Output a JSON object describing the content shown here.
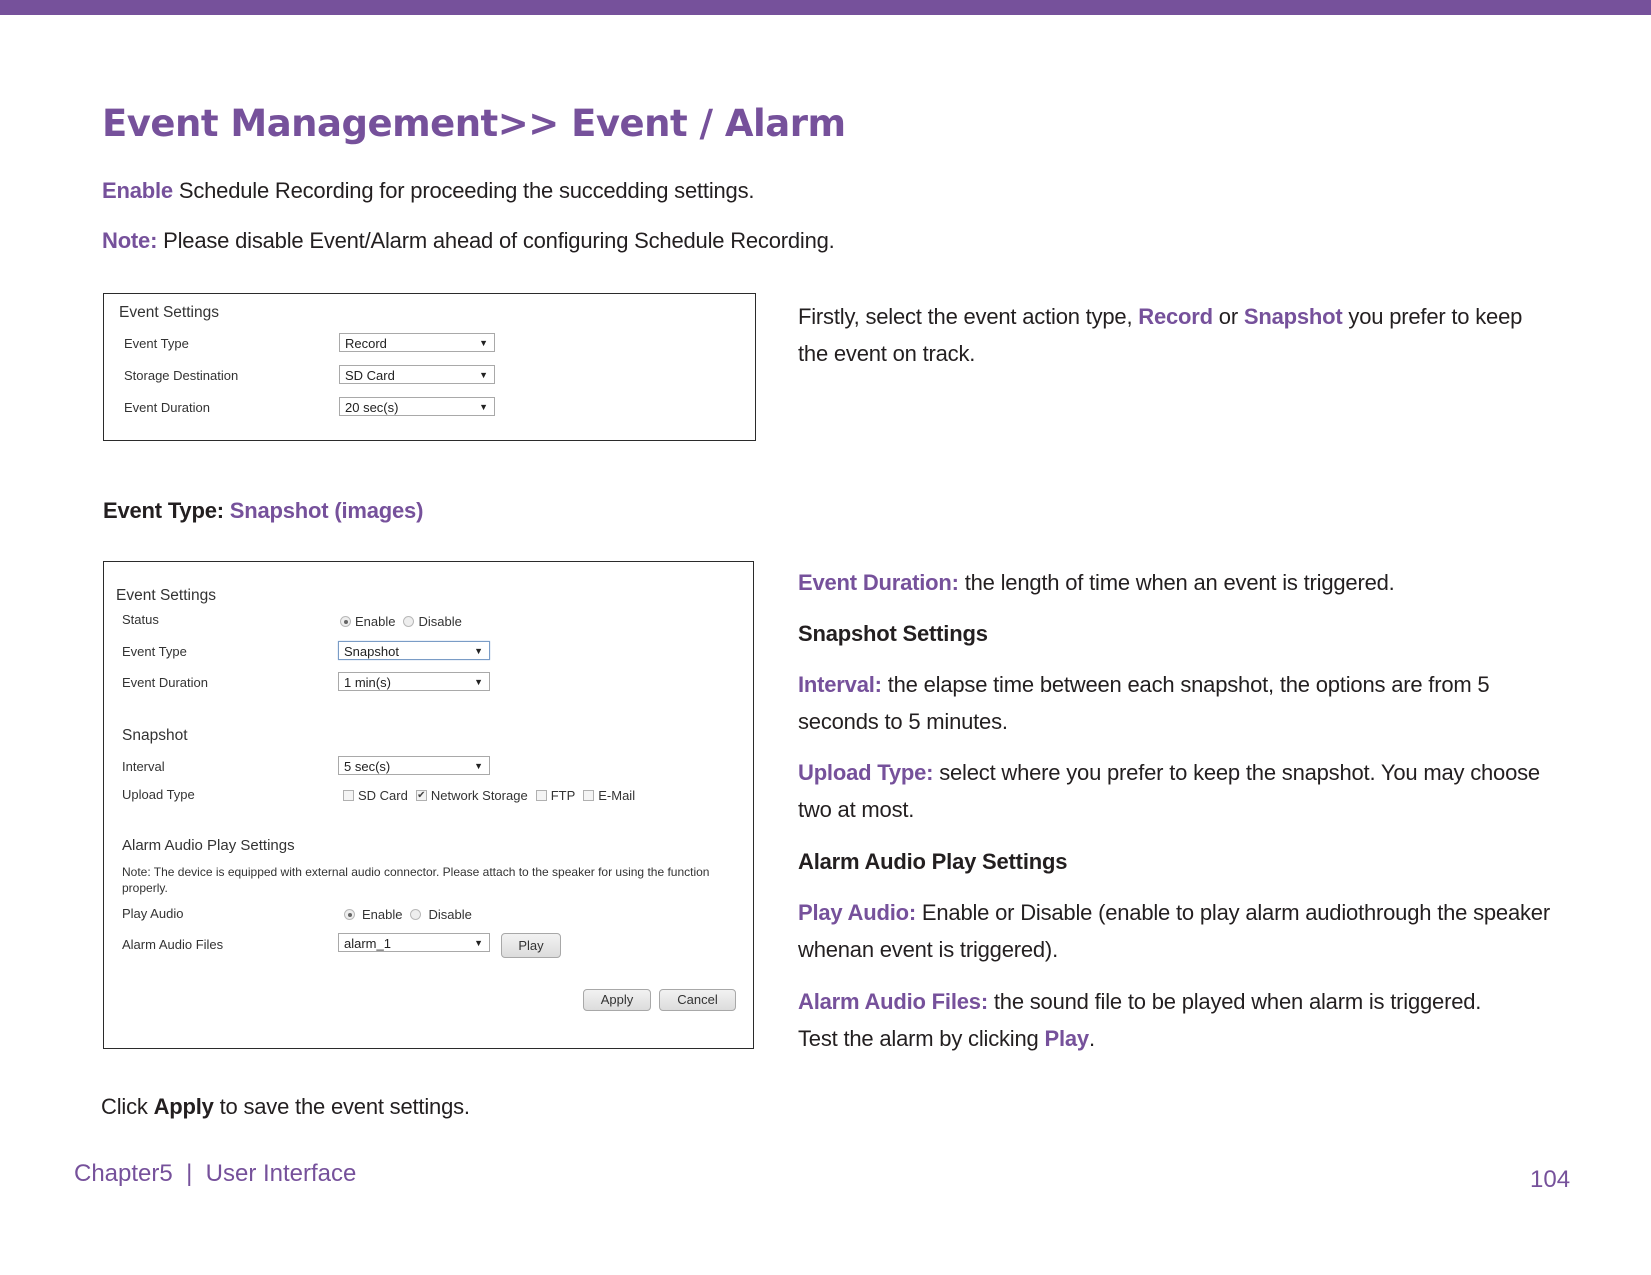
{
  "page": {
    "title": "Event Management>> Event / Alarm",
    "intro": [
      {
        "label": "Enable",
        "text": " Schedule Recording for proceeding the succedding settings."
      },
      {
        "label": "Note:",
        "text": " Please disable Event/Alarm ahead of configuring Schedule Recording."
      }
    ],
    "accent_color": "#76519b"
  },
  "panel1": {
    "section_title": "Event Settings",
    "rows": [
      {
        "label": "Event Type",
        "value": "Record"
      },
      {
        "label": "Storage Destination",
        "value": "SD Card"
      },
      {
        "label": "Event Duration",
        "value": "20 sec(s)"
      }
    ]
  },
  "desc1": {
    "pre": "Firstly, select the event action type, ",
    "opt1": "Record",
    "mid": " or ",
    "opt2": "Snapshot",
    "post": " you prefer to keep the event on track."
  },
  "event_type_heading": {
    "label": "Event Type: ",
    "value": "Snapshot (images)"
  },
  "panel2": {
    "section_title": "Event Settings",
    "status": {
      "label": "Status",
      "options": [
        "Enable",
        "Disable"
      ],
      "selected": "Enable"
    },
    "event_type": {
      "label": "Event Type",
      "value": "Snapshot"
    },
    "event_duration": {
      "label": "Event Duration",
      "value": "1 min(s)"
    },
    "snapshot_title": "Snapshot",
    "interval": {
      "label": "Interval",
      "value": "5 sec(s)"
    },
    "upload_type": {
      "label": "Upload Type",
      "options": [
        {
          "label": "SD Card",
          "checked": false
        },
        {
          "label": "Network Storage",
          "checked": true
        },
        {
          "label": "FTP",
          "checked": false
        },
        {
          "label": "E-Mail",
          "checked": false
        }
      ]
    },
    "alarm_title": "Alarm Audio Play Settings",
    "alarm_note": "Note: The device is equipped with external audio connector. Please attach to the speaker for using the function properly.",
    "play_audio": {
      "label": "Play Audio",
      "options": [
        "Enable",
        "Disable"
      ],
      "selected": "Enable"
    },
    "alarm_files": {
      "label": "Alarm Audio Files",
      "value": "alarm_1",
      "play_label": "Play"
    },
    "apply_label": "Apply",
    "cancel_label": "Cancel"
  },
  "desc2": {
    "event_duration": {
      "label": "Event Duration:",
      "text": " the length of time when an event is triggered."
    },
    "snapshot_heading": "Snapshot Settings",
    "interval": {
      "label": "Interval:",
      "text": " the elapse time between each snapshot, the options are from 5 seconds to 5 minutes."
    },
    "upload_type": {
      "label": "Upload Type:",
      "text": " select where you prefer to keep the snapshot. You may choose two at most."
    },
    "alarm_heading": "Alarm Audio Play Settings",
    "play_audio": {
      "label": "Play Audio:",
      "text": " Enable or Disable (enable to play alarm audiothrough the speaker whenan event is triggered)."
    },
    "alarm_files": {
      "label": "Alarm Audio Files:",
      "text": " the sound file to be played when alarm is triggered. Test the alarm by clicking ",
      "link": "Play",
      "end": "."
    }
  },
  "footer_note": {
    "pre": "Click ",
    "bold": "Apply",
    "post": " to save the event settings."
  },
  "footer": {
    "chapter": "Chapter5  |  User Interface",
    "page_number": "104"
  }
}
